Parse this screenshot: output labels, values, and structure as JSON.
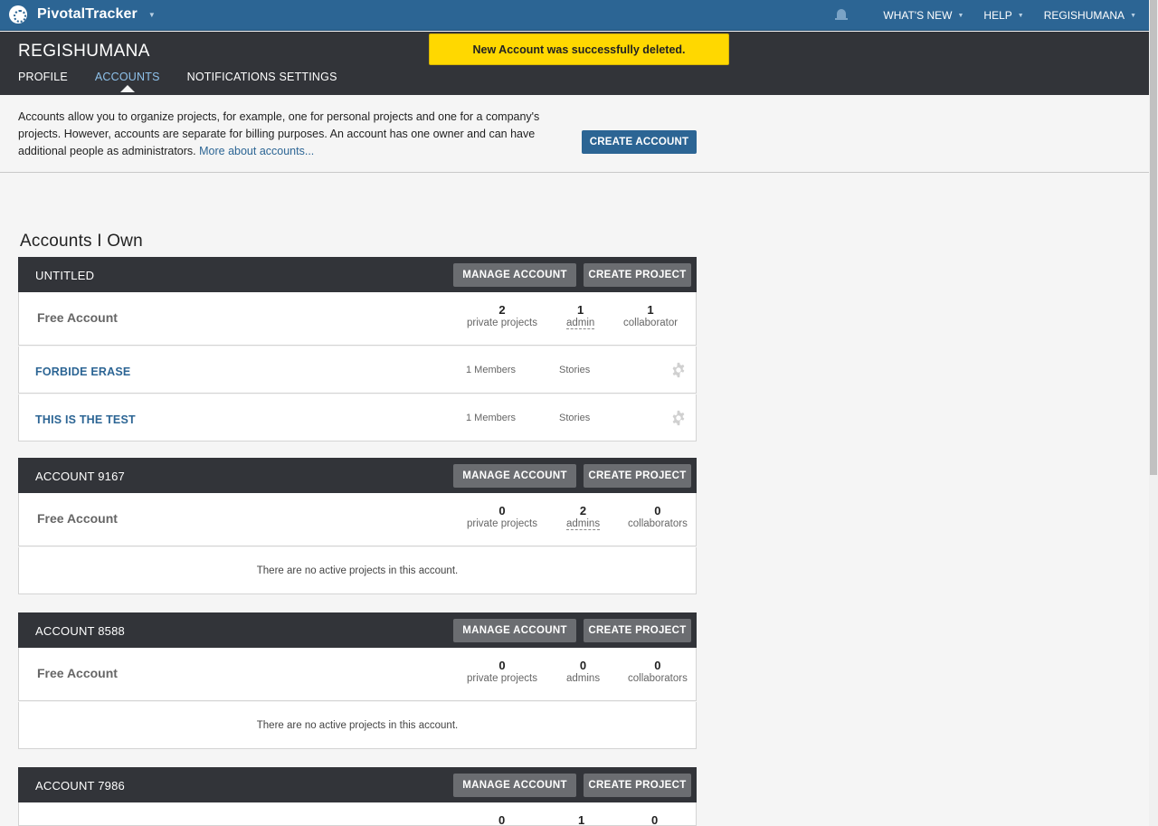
{
  "topbar": {
    "brand": "PivotalTracker",
    "nav": [
      {
        "label": "WHAT'S NEW"
      },
      {
        "label": "HELP"
      },
      {
        "label": "REGISHUMANA"
      }
    ]
  },
  "header": {
    "username": "REGISHUMANA",
    "tabs": [
      {
        "label": "PROFILE"
      },
      {
        "label": "ACCOUNTS"
      },
      {
        "label": "NOTIFICATIONS SETTINGS"
      }
    ]
  },
  "flash": {
    "message": "New Account was successfully deleted."
  },
  "intro": {
    "text": "Accounts allow you to organize projects, for example, one for personal projects and one for a company's projects. However, accounts are separate for billing purposes. An account has one owner and can have additional people as administrators. ",
    "link": "More about accounts...",
    "create_account": "CREATE ACCOUNT"
  },
  "section_title": "Accounts I Own",
  "labels": {
    "manage_account": "MANAGE ACCOUNT",
    "create_project": "CREATE PROJECT",
    "plan": "Free Account",
    "no_projects": "There are no active projects in this account."
  },
  "accounts": [
    {
      "name": "UNTITLED",
      "stats": [
        {
          "num": "2",
          "label": "private projects"
        },
        {
          "num": "1",
          "label": "admin"
        },
        {
          "num": "1",
          "label": "collaborator"
        }
      ],
      "projects": [
        {
          "name": "FORBIDE ERASE",
          "members": "1 Members",
          "stories": "Stories"
        },
        {
          "name": "THIS IS THE TEST",
          "members": "1 Members",
          "stories": "Stories"
        }
      ]
    },
    {
      "name": "ACCOUNT 9167",
      "stats": [
        {
          "num": "0",
          "label": "private projects"
        },
        {
          "num": "2",
          "label": "admins"
        },
        {
          "num": "0",
          "label": "collaborators"
        }
      ]
    },
    {
      "name": "ACCOUNT 8588",
      "stats": [
        {
          "num": "0",
          "label": "private projects"
        },
        {
          "num": "0",
          "label": "admins"
        },
        {
          "num": "0",
          "label": "collaborators"
        }
      ]
    },
    {
      "name": "ACCOUNT 7986",
      "stats": [
        {
          "num": "0",
          "label": ""
        },
        {
          "num": "1",
          "label": ""
        },
        {
          "num": "0",
          "label": ""
        }
      ]
    }
  ]
}
